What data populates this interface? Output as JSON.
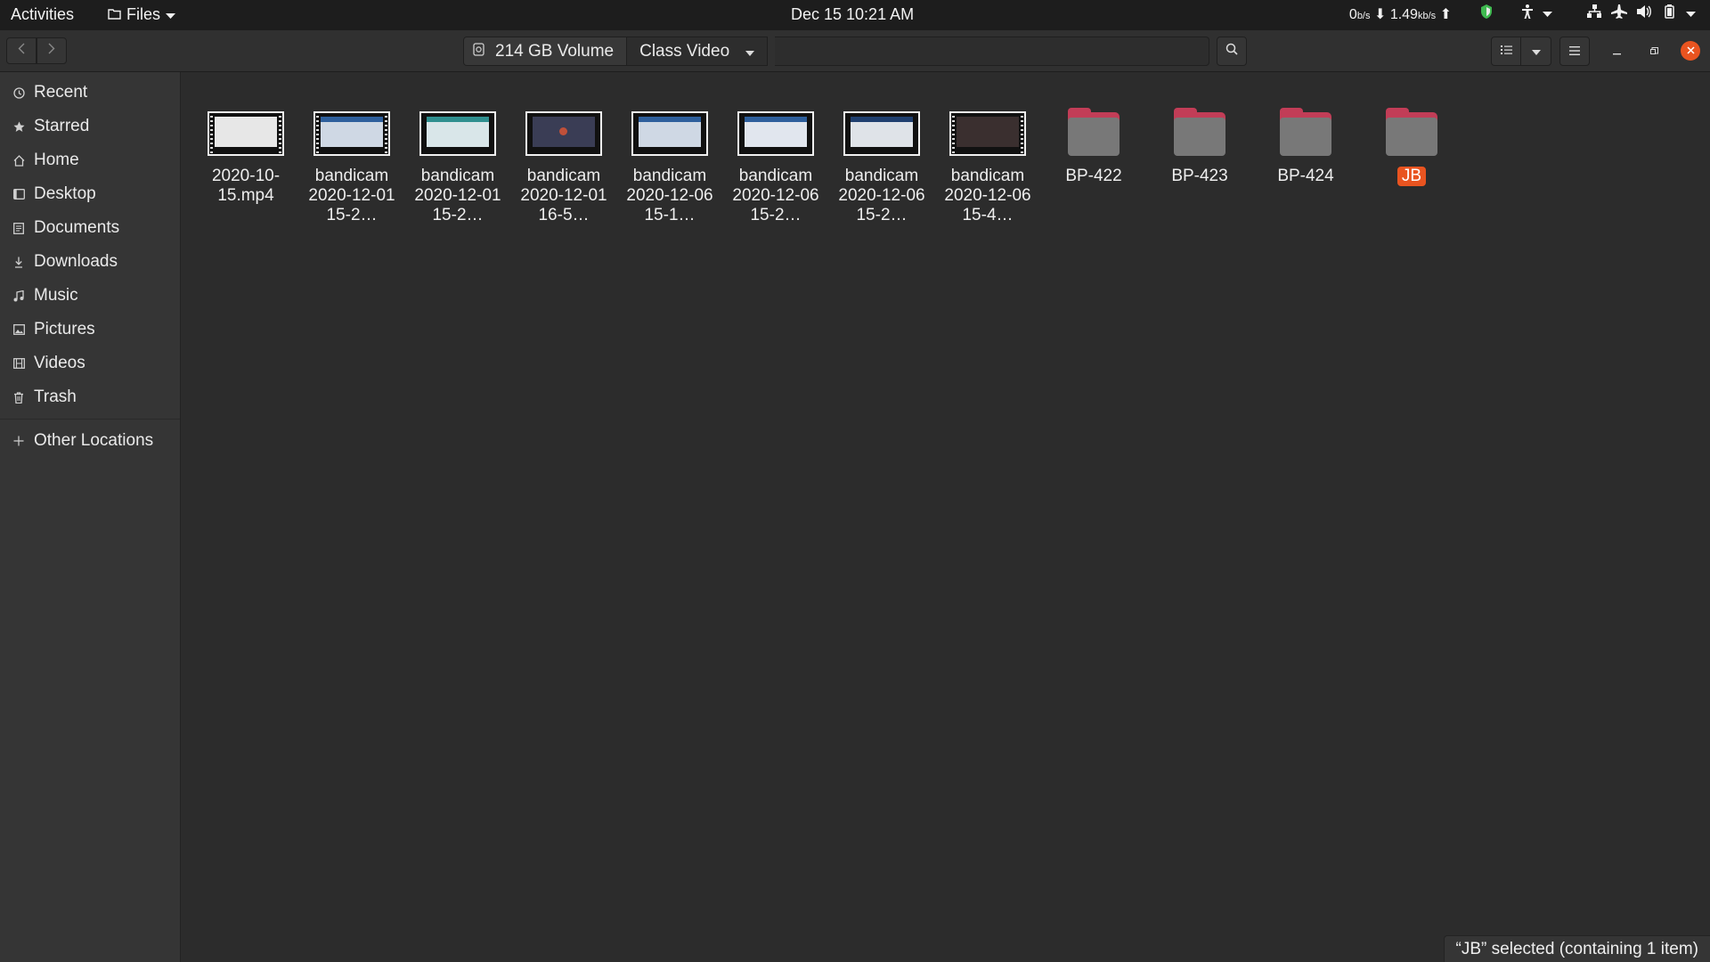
{
  "topbar": {
    "activities": "Activities",
    "app_menu": "Files",
    "clock": "Dec 15  10:21 AM",
    "net_down": "0",
    "net_down_unit": "b/s",
    "net_up": "1.49",
    "net_up_unit": "kb/s"
  },
  "header": {
    "volume": "214 GB Volume",
    "current_folder": "Class Video"
  },
  "sidebar": {
    "items": [
      {
        "label": "Recent",
        "icon": "clock-icon"
      },
      {
        "label": "Starred",
        "icon": "star-icon"
      },
      {
        "label": "Home",
        "icon": "home-icon"
      },
      {
        "label": "Desktop",
        "icon": "desktop-icon"
      },
      {
        "label": "Documents",
        "icon": "documents-icon"
      },
      {
        "label": "Downloads",
        "icon": "downloads-icon"
      },
      {
        "label": "Music",
        "icon": "music-icon"
      },
      {
        "label": "Pictures",
        "icon": "pictures-icon"
      },
      {
        "label": "Videos",
        "icon": "videos-icon"
      },
      {
        "label": "Trash",
        "icon": "trash-icon"
      }
    ],
    "other_locations": "Other Locations"
  },
  "files": [
    {
      "name": "2020-10-15.mp4",
      "kind": "video"
    },
    {
      "name": "bandicam 2020-12-01 15-2…",
      "kind": "video"
    },
    {
      "name": "bandicam 2020-12-01 15-2…",
      "kind": "video"
    },
    {
      "name": "bandicam 2020-12-01 16-5…",
      "kind": "video"
    },
    {
      "name": "bandicam 2020-12-06 15-1…",
      "kind": "video"
    },
    {
      "name": "bandicam 2020-12-06 15-2…",
      "kind": "video"
    },
    {
      "name": "bandicam 2020-12-06 15-2…",
      "kind": "video"
    },
    {
      "name": "bandicam 2020-12-06 15-4…",
      "kind": "video"
    },
    {
      "name": "BP-422",
      "kind": "folder"
    },
    {
      "name": "BP-423",
      "kind": "folder"
    },
    {
      "name": "BP-424",
      "kind": "folder"
    },
    {
      "name": "JB",
      "kind": "folder",
      "selected": true
    }
  ],
  "status": "“JB” selected  (containing 1 item)",
  "colors": {
    "accent": "#e95420",
    "folder_tab": "#c23d57",
    "folder_body": "#787878"
  }
}
